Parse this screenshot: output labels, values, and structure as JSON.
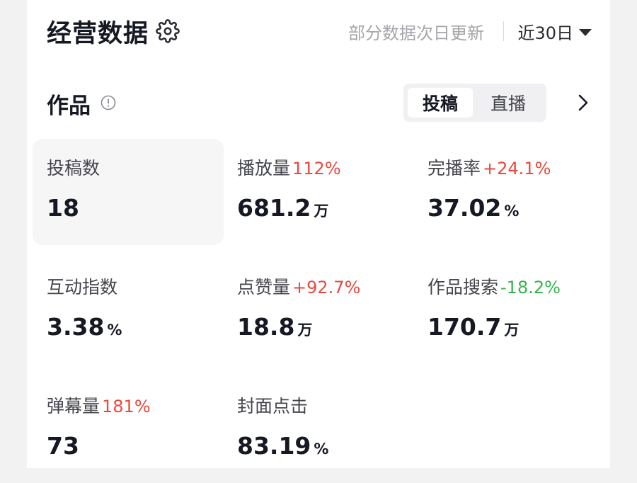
{
  "header": {
    "title": "经营数据",
    "note": "部分数据次日更新",
    "range": "近30日"
  },
  "section": {
    "title": "作品",
    "tabs": [
      "投稿",
      "直播"
    ],
    "active_tab": "投稿"
  },
  "metrics": [
    {
      "label": "投稿数",
      "value": "18",
      "unit": "",
      "change": "",
      "trend": ""
    },
    {
      "label": "播放量",
      "value": "681.2",
      "unit": "万",
      "change": "112%",
      "trend": "up"
    },
    {
      "label": "完播率",
      "value": "37.02",
      "unit": "%",
      "change": "+24.1%",
      "trend": "up"
    },
    {
      "label": "互动指数",
      "value": "3.38",
      "unit": "%",
      "change": "",
      "trend": ""
    },
    {
      "label": "点赞量",
      "value": "18.8",
      "unit": "万",
      "change": "+92.7%",
      "trend": "up"
    },
    {
      "label": "作品搜索",
      "value": "170.7",
      "unit": "万",
      "change": "-18.2%",
      "trend": "down"
    },
    {
      "label": "弹幕量",
      "value": "73",
      "unit": "",
      "change": "181%",
      "trend": "up"
    },
    {
      "label": "封面点击",
      "value": "83.19",
      "unit": "%",
      "change": "",
      "trend": ""
    }
  ],
  "colors": {
    "increase": "#e8493e",
    "decrease": "#35b34f",
    "text": "#161823",
    "muted": "#a6a6ab"
  }
}
